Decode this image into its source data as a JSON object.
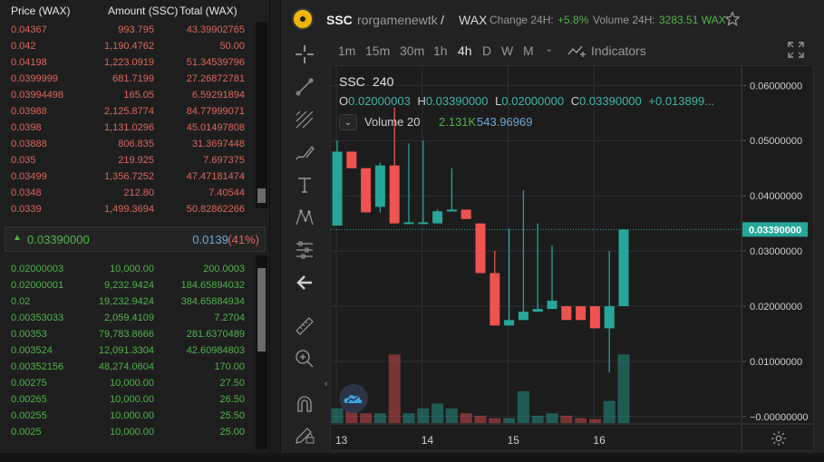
{
  "orderbook": {
    "headers": {
      "price": "Price (WAX)",
      "amount": "Amount (SSC)",
      "total": "Total (WAX)"
    },
    "asks": [
      {
        "price": "0.04367",
        "amount": "993.795",
        "total": "43.39902765"
      },
      {
        "price": "0.042",
        "amount": "1,190.4762",
        "total": "50.00"
      },
      {
        "price": "0.04198",
        "amount": "1,223.0919",
        "total": "51.34539796"
      },
      {
        "price": "0.0399999",
        "amount": "681.7199",
        "total": "27.26872781"
      },
      {
        "price": "0.03994498",
        "amount": "165.05",
        "total": "6.59291894"
      },
      {
        "price": "0.03988",
        "amount": "2,125.8774",
        "total": "84.77999071"
      },
      {
        "price": "0.0398",
        "amount": "1,131.0296",
        "total": "45.01497808"
      },
      {
        "price": "0.03888",
        "amount": "806.835",
        "total": "31.3697448"
      },
      {
        "price": "0.035",
        "amount": "219.925",
        "total": "7.697375"
      },
      {
        "price": "0.03499",
        "amount": "1,356.7252",
        "total": "47.47181474"
      },
      {
        "price": "0.0348",
        "amount": "212.80",
        "total": "7.40544"
      },
      {
        "price": "0.0339",
        "amount": "1,499.3694",
        "total": "50.82862266"
      }
    ],
    "mid": {
      "price": "0.03390000",
      "spread": "0.0139",
      "spread_pct": "(41%)"
    },
    "bids": [
      {
        "price": "0.02000003",
        "amount": "10,000.00",
        "total": "200.0003"
      },
      {
        "price": "0.02000001",
        "amount": "9,232.9424",
        "total": "184.65894032"
      },
      {
        "price": "0.02",
        "amount": "19,232.9424",
        "total": "384.65884934"
      },
      {
        "price": "0.00353033",
        "amount": "2,059.4109",
        "total": "7.2704"
      },
      {
        "price": "0.00353",
        "amount": "79,783.8666",
        "total": "281.6370489"
      },
      {
        "price": "0.003524",
        "amount": "12,091.3304",
        "total": "42.60984803"
      },
      {
        "price": "0.00352156",
        "amount": "48,274.0604",
        "total": "170.00"
      },
      {
        "price": "0.00275",
        "amount": "10,000.00",
        "total": "27.50"
      },
      {
        "price": "0.00265",
        "amount": "10,000.00",
        "total": "26.50"
      },
      {
        "price": "0.00255",
        "amount": "10,000.00",
        "total": "25.50"
      },
      {
        "price": "0.0025",
        "amount": "10,000.00",
        "total": "25.00"
      }
    ]
  },
  "symbol": {
    "ticker": "SSC",
    "issuer": "rorgamenewtk",
    "separator": "/",
    "quote": "WAX",
    "change_label": "Change 24H:",
    "change_value": "+5.8%",
    "volume_label": "Volume 24H:",
    "volume_value": "3283.51 WAX"
  },
  "toolbar": {
    "timeframes": [
      "1m",
      "15m",
      "30m",
      "1h",
      "4h",
      "D",
      "W",
      "M"
    ],
    "active_timeframe": "4h",
    "more_icon": "chevron-down",
    "indicators_label": "Indicators"
  },
  "legend": {
    "symbol": "SSC",
    "interval": "240",
    "ohlc": [
      {
        "label": "O",
        "value": "0.02000003"
      },
      {
        "label": "H",
        "value": "0.03390000"
      },
      {
        "label": "L",
        "value": "0.02000000"
      },
      {
        "label": "C",
        "value": "0.03390000"
      }
    ],
    "change": "+0.013899...",
    "volume_name": "Volume 20",
    "volume_a": "2.131K",
    "volume_b": "543.96969"
  },
  "icons": [
    "crosshair-icon",
    "trendline-icon",
    "fib-icon",
    "brush-icon",
    "text-icon",
    "pattern-icon",
    "forecast-icon",
    "back-arrow-icon",
    "ruler-icon",
    "zoom-in-icon",
    "magnet-icon",
    "lock-pencil-icon",
    "star-icon",
    "fullscreen-icon",
    "settings-icon"
  ],
  "colors": {
    "up": "#26a69a",
    "down": "#ef5350",
    "price_label_bg": "#26a69a",
    "last_price_line": "#26a69a"
  },
  "chart_data": {
    "type": "candlestick",
    "interval": "4h",
    "x_tick_labels": [
      "13",
      "14",
      "15",
      "16"
    ],
    "y_tick_labels": [
      "0.06000000",
      "0.05000000",
      "0.04000000",
      "0.03000000",
      "0.02000000",
      "0.01000000",
      "-0.00000000"
    ],
    "ylim": [
      -0.0015,
      0.0635
    ],
    "last_price": "0.03390000",
    "candles": [
      {
        "open": 0.0346,
        "high": 0.05,
        "low": 0.0346,
        "close": 0.048
      },
      {
        "open": 0.048,
        "high": 0.048,
        "low": 0.045,
        "close": 0.045
      },
      {
        "open": 0.045,
        "high": 0.045,
        "low": 0.037,
        "close": 0.037
      },
      {
        "open": 0.038,
        "high": 0.046,
        "low": 0.037,
        "close": 0.0455
      },
      {
        "open": 0.0455,
        "high": 0.056,
        "low": 0.035,
        "close": 0.035
      },
      {
        "open": 0.035,
        "high": 0.0495,
        "low": 0.035,
        "close": 0.0352
      },
      {
        "open": 0.035,
        "high": 0.05,
        "low": 0.035,
        "close": 0.0352
      },
      {
        "open": 0.035,
        "high": 0.0375,
        "low": 0.035,
        "close": 0.0372
      },
      {
        "open": 0.0372,
        "high": 0.045,
        "low": 0.0372,
        "close": 0.0375
      },
      {
        "open": 0.0375,
        "high": 0.0375,
        "low": 0.0358,
        "close": 0.0358
      },
      {
        "open": 0.035,
        "high": 0.035,
        "low": 0.026,
        "close": 0.026
      },
      {
        "open": 0.026,
        "high": 0.03,
        "low": 0.0165,
        "close": 0.0165
      },
      {
        "open": 0.0165,
        "high": 0.034,
        "low": 0.0165,
        "close": 0.0175
      },
      {
        "open": 0.0175,
        "high": 0.041,
        "low": 0.0175,
        "close": 0.019
      },
      {
        "open": 0.019,
        "high": 0.035,
        "low": 0.019,
        "close": 0.0195
      },
      {
        "open": 0.0195,
        "high": 0.031,
        "low": 0.0195,
        "close": 0.021
      },
      {
        "open": 0.02,
        "high": 0.02,
        "low": 0.0175,
        "close": 0.0175
      },
      {
        "open": 0.02,
        "high": 0.02,
        "low": 0.0175,
        "close": 0.0175
      },
      {
        "open": 0.02,
        "high": 0.02,
        "low": 0.016,
        "close": 0.016
      },
      {
        "open": 0.016,
        "high": 0.03,
        "low": 0.008,
        "close": 0.02
      },
      {
        "open": 0.02,
        "high": 0.0339,
        "low": 0.02,
        "close": 0.0339
      }
    ],
    "volume": [
      3,
      3,
      2,
      2,
      14,
      2,
      3,
      4,
      3,
      2,
      1.5,
      1,
      1,
      6.5,
      1.5,
      2,
      1.5,
      1,
      0.8,
      4.5,
      14
    ],
    "volume_scale_max": 17
  }
}
